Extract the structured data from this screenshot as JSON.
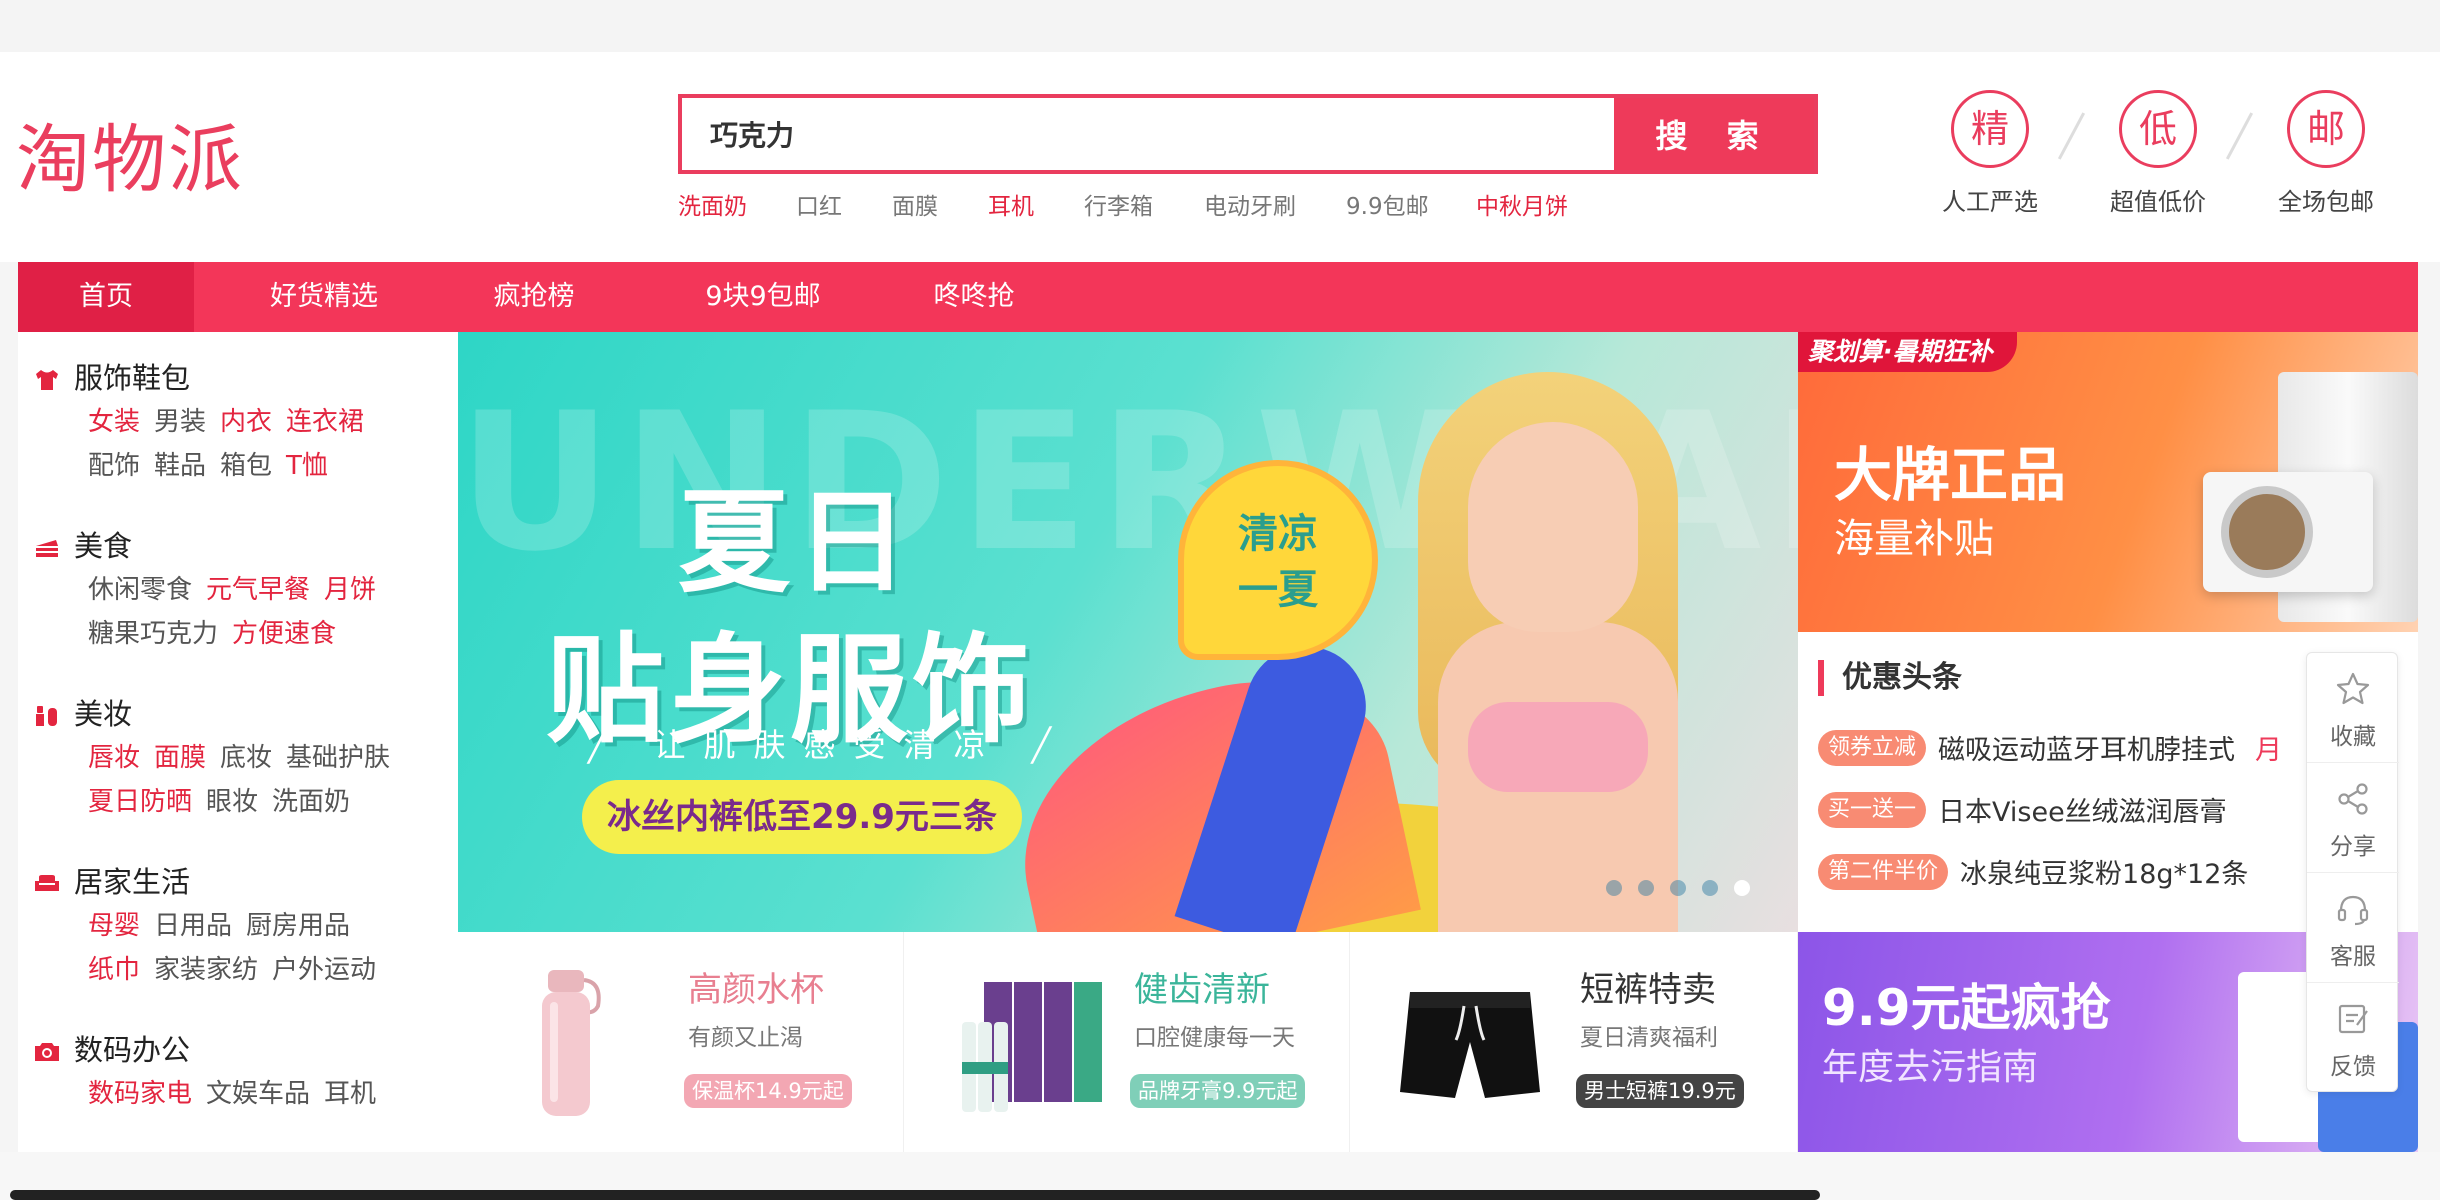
{
  "header": {
    "logo": "淘物派",
    "search": {
      "value": "巧克力",
      "button": "搜 索"
    },
    "hotwords": [
      {
        "label": "洗面奶",
        "red": true
      },
      {
        "label": "口红",
        "red": false
      },
      {
        "label": "面膜",
        "red": false
      },
      {
        "label": "耳机",
        "red": true
      },
      {
        "label": "行李箱",
        "red": false
      },
      {
        "label": "电动牙刷",
        "red": false
      },
      {
        "label": "9.9包邮",
        "red": false
      },
      {
        "label": "中秋月饼",
        "red": true
      }
    ],
    "features": [
      {
        "char": "精",
        "label": "人工严选"
      },
      {
        "char": "低",
        "label": "超值低价"
      },
      {
        "char": "邮",
        "label": "全场包邮"
      }
    ]
  },
  "nav": {
    "items": [
      "首页",
      "好货精选",
      "疯抢榜",
      "9块9包邮",
      "咚咚抢"
    ]
  },
  "categories": [
    {
      "title": "服饰鞋包",
      "icon": "shirt-icon",
      "links": [
        {
          "label": "女装",
          "red": true
        },
        {
          "label": "男装",
          "red": false
        },
        {
          "label": "内衣",
          "red": true
        },
        {
          "label": "连衣裙",
          "red": true
        },
        {
          "label": "配饰",
          "red": false
        },
        {
          "label": "鞋品",
          "red": false
        },
        {
          "label": "箱包",
          "red": false
        },
        {
          "label": "T恤",
          "red": true
        }
      ]
    },
    {
      "title": "美食",
      "icon": "cake-icon",
      "links": [
        {
          "label": "休闲零食",
          "red": false
        },
        {
          "label": "元气早餐",
          "red": true
        },
        {
          "label": "月饼",
          "red": true
        },
        {
          "label": "糖果巧克力",
          "red": false
        },
        {
          "label": "方便速食",
          "red": true
        }
      ]
    },
    {
      "title": "美妆",
      "icon": "cosmetics-icon",
      "links": [
        {
          "label": "唇妆",
          "red": true
        },
        {
          "label": "面膜",
          "red": true
        },
        {
          "label": "底妆",
          "red": false
        },
        {
          "label": "基础护肤",
          "red": false
        },
        {
          "label": "夏日防晒",
          "red": true
        },
        {
          "label": "眼妆",
          "red": false
        },
        {
          "label": "洗面奶",
          "red": false
        }
      ]
    },
    {
      "title": "居家生活",
      "icon": "sofa-icon",
      "links": [
        {
          "label": "母婴",
          "red": true
        },
        {
          "label": "日用品",
          "red": false
        },
        {
          "label": "厨房用品",
          "red": false
        },
        {
          "label": "纸巾",
          "red": true
        },
        {
          "label": "家装家纺",
          "red": false
        },
        {
          "label": "户外运动",
          "red": false
        }
      ]
    },
    {
      "title": "数码办公",
      "icon": "camera-icon",
      "links": [
        {
          "label": "数码家电",
          "red": true
        },
        {
          "label": "文娱车品",
          "red": false
        },
        {
          "label": "耳机",
          "red": false
        }
      ]
    }
  ],
  "banner": {
    "bg_word": "UNDERWEAR",
    "title1": "夏日",
    "title2": "贴身服饰",
    "subtitle": "╱ 让肌肤感受清凉 ╱",
    "pill": "冰丝内裤低至29.9元三条",
    "badge_line1": "清凉",
    "badge_line2": "一夏",
    "dots": 5,
    "active_dot": 4
  },
  "promos": [
    {
      "title": "高颜水杯",
      "sub": "有颜又止渴",
      "tag": "保温杯14.9元起",
      "title_color": "#e87f90",
      "tag_color": "#f3a7b3",
      "icon": "thermos-icon"
    },
    {
      "title": "健齿清新",
      "sub": "口腔健康每一天",
      "tag": "品牌牙膏9.9元起",
      "title_color": "#3bb59a",
      "tag_color": "#7fcfb8",
      "icon": "toothpaste-icon"
    },
    {
      "title": "短裤特卖",
      "sub": "夏日清爽福利",
      "tag": "男士短裤19.9元",
      "title_color": "#333333",
      "tag_color": "#444444",
      "icon": "shorts-icon"
    }
  ],
  "juhuasuan": {
    "badge": "聚划算·暑期狂补",
    "title": "大牌正品",
    "sub": "海量补贴"
  },
  "deals": {
    "title": "优惠头条",
    "items": [
      {
        "tag": "领券立减",
        "text": "磁吸运动蓝牙耳机脖挂式",
        "extra": "月"
      },
      {
        "tag": "买一送一",
        "text": "日本Visee丝绒滋润唇膏",
        "extra": ""
      },
      {
        "tag": "第二件半价",
        "text": "冰泉纯豆浆粉18g*12条",
        "extra": ""
      }
    ]
  },
  "purple_banner": {
    "title": "9.9元起疯抢",
    "sub": "年度去污指南"
  },
  "floatbar": [
    {
      "label": "收藏",
      "icon": "star-icon"
    },
    {
      "label": "分享",
      "icon": "share-icon"
    },
    {
      "label": "客服",
      "icon": "headset-icon"
    },
    {
      "label": "反馈",
      "icon": "feedback-icon"
    }
  ],
  "colors": {
    "brand": "#ee3a5a",
    "nav": "#f33659",
    "nav_active": "#e02046",
    "link_red": "#e3253f"
  }
}
